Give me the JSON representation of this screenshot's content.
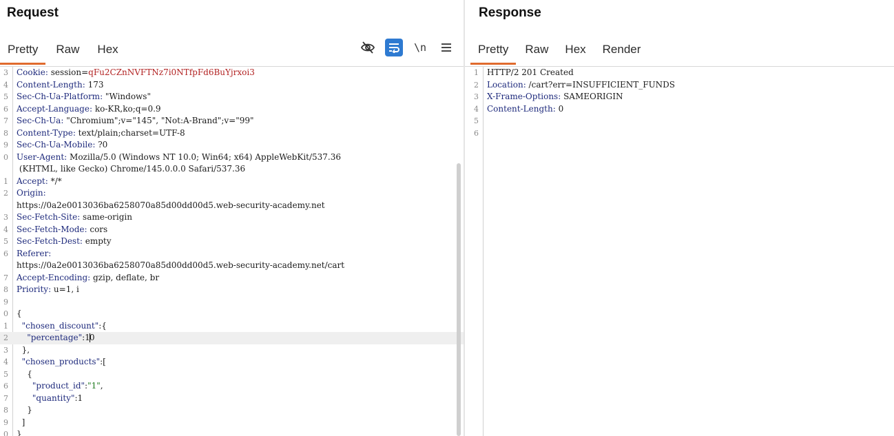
{
  "request": {
    "title": "Request",
    "tabs": [
      "Pretty",
      "Raw",
      "Hex"
    ],
    "active_tab": "Pretty",
    "toolbar": {
      "hide_icon": "eye-slash-icon",
      "wrap_icon": "word-wrap-icon",
      "newline_label": "\\n",
      "menu_icon": "hamburger-menu-icon",
      "accent": "#2e7ad1"
    },
    "lines": [
      {
        "n": "3",
        "k": "Cookie",
        "v": " session=",
        "r": "qFu2CZnNVFTNz7i0NTfpFd6BuYjrxoi3"
      },
      {
        "n": "4",
        "k": "Content-Length",
        "v": " 173"
      },
      {
        "n": "5",
        "k": "Sec-Ch-Ua-Platform",
        "v": " \"Windows\""
      },
      {
        "n": "6",
        "k": "Accept-Language",
        "v": " ko-KR,ko;q=0.9"
      },
      {
        "n": "7",
        "k": "Sec-Ch-Ua",
        "v": " \"Chromium\";v=\"145\", \"Not:A-Brand\";v=\"99\""
      },
      {
        "n": "8",
        "k": "Content-Type",
        "v": " text/plain;charset=UTF-8"
      },
      {
        "n": "9",
        "k": "Sec-Ch-Ua-Mobile",
        "v": " ?0"
      },
      {
        "n": "0",
        "k": "User-Agent",
        "v": " Mozilla/5.0 (Windows NT 10.0; Win64; x64) AppleWebKit/537.36"
      },
      {
        "n": "",
        "t": " (KHTML, like Gecko) Chrome/145.0.0.0 Safari/537.36"
      },
      {
        "n": "1",
        "k": "Accept",
        "v": " */*"
      },
      {
        "n": "2",
        "k": "Origin",
        "v": ""
      },
      {
        "n": "",
        "t": "https://0a2e0013036ba6258070a85d00dd00d5.web-security-academy.net"
      },
      {
        "n": "3",
        "k": "Sec-Fetch-Site",
        "v": " same-origin"
      },
      {
        "n": "4",
        "k": "Sec-Fetch-Mode",
        "v": " cors"
      },
      {
        "n": "5",
        "k": "Sec-Fetch-Dest",
        "v": " empty"
      },
      {
        "n": "6",
        "k": "Referer",
        "v": ""
      },
      {
        "n": "",
        "t": "https://0a2e0013036ba6258070a85d00dd00d5.web-security-academy.net/cart"
      },
      {
        "n": "7",
        "k": "Accept-Encoding",
        "v": " gzip, deflate, br"
      },
      {
        "n": "8",
        "k": "Priority",
        "v": " u=1, i"
      },
      {
        "n": "9",
        "t": ""
      },
      {
        "n": "0",
        "t": "{"
      },
      {
        "n": "1",
        "t": "  ",
        "j": "\"chosen_discount\"",
        "a": ":{"
      },
      {
        "n": "2",
        "t": "    ",
        "j": "\"percentage\"",
        "a": ":1",
        "caret": true,
        "b": "0",
        "hl": true
      },
      {
        "n": "3",
        "t": "  },"
      },
      {
        "n": "4",
        "t": "  ",
        "j": "\"chosen_products\"",
        "a": ":["
      },
      {
        "n": "5",
        "t": "    {"
      },
      {
        "n": "6",
        "t": "      ",
        "j": "\"product_id\"",
        "a": ":",
        "s": "\"1\"",
        "z": ","
      },
      {
        "n": "7",
        "t": "      ",
        "j": "\"quantity\"",
        "a": ":1"
      },
      {
        "n": "8",
        "t": "    }"
      },
      {
        "n": "9",
        "t": "  ]"
      },
      {
        "n": "0",
        "t": "}"
      }
    ]
  },
  "response": {
    "title": "Response",
    "tabs": [
      "Pretty",
      "Raw",
      "Hex",
      "Render"
    ],
    "active_tab": "Pretty",
    "lines": [
      {
        "n": "1",
        "t": "HTTP/2 201 Created"
      },
      {
        "n": "2",
        "k": "Location",
        "v": " /cart?err=INSUFFICIENT_FUNDS"
      },
      {
        "n": "3",
        "k": "X-Frame-Options",
        "v": " SAMEORIGIN"
      },
      {
        "n": "4",
        "k": "Content-Length",
        "v": " 0"
      },
      {
        "n": "5",
        "t": ""
      },
      {
        "n": "6",
        "t": ""
      }
    ]
  },
  "colors": {
    "tab_underline": "#e06b2e",
    "header_key": "#1e2a7c",
    "cookie_value": "#b22222",
    "json_string": "#1c7a1c"
  }
}
